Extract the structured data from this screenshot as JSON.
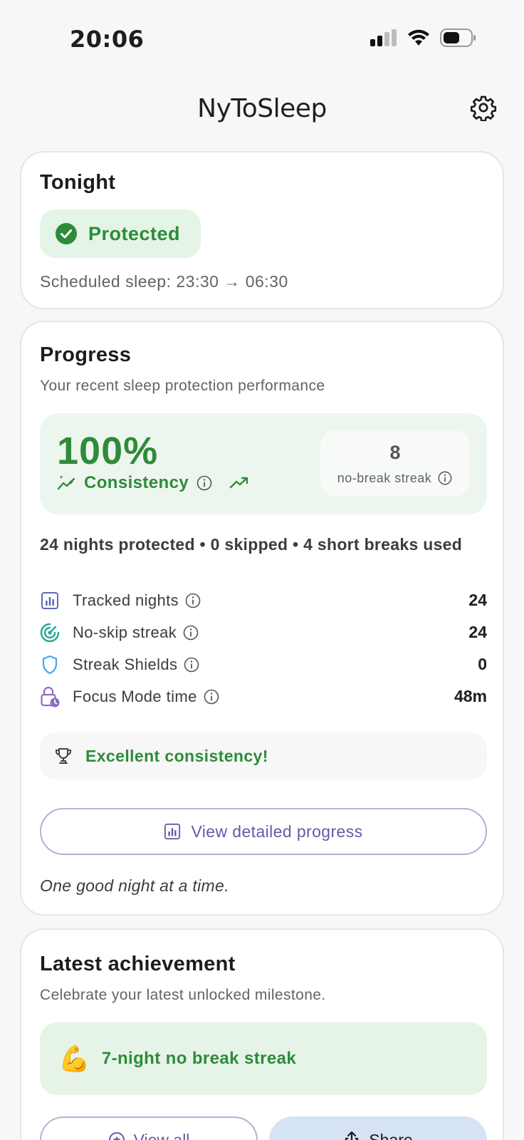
{
  "status_bar": {
    "time": "20:06"
  },
  "header": {
    "title": "NyToSleep"
  },
  "tonight": {
    "title": "Tonight",
    "status": "Protected",
    "schedule": "Scheduled sleep: 23:30 → 06:30"
  },
  "progress": {
    "title": "Progress",
    "subtitle": "Your recent sleep protection performance",
    "consistency_pct": "100%",
    "consistency_label": "Consistency",
    "streak_value": "8",
    "streak_label": "no-break streak",
    "summary": "24 nights protected • 0 skipped • 4 short breaks used",
    "stats": [
      {
        "label": "Tracked nights",
        "value": "24"
      },
      {
        "label": "No-skip streak",
        "value": "24"
      },
      {
        "label": "Streak Shields",
        "value": "0"
      },
      {
        "label": "Focus Mode time",
        "value": "48m"
      }
    ],
    "badge": "Excellent consistency!",
    "details_button": "View detailed progress",
    "motto": "One good night at a time."
  },
  "achievement": {
    "title": "Latest achievement",
    "subtitle": "Celebrate your latest unlocked milestone.",
    "emoji": "💪",
    "name": "7-night no break streak",
    "view_all_button": "View all",
    "share_button": "Share"
  },
  "colors": {
    "accent_green": "#2e8b3a",
    "accent_purple": "#6a58a6",
    "share_blue": "#d5e3f4"
  }
}
